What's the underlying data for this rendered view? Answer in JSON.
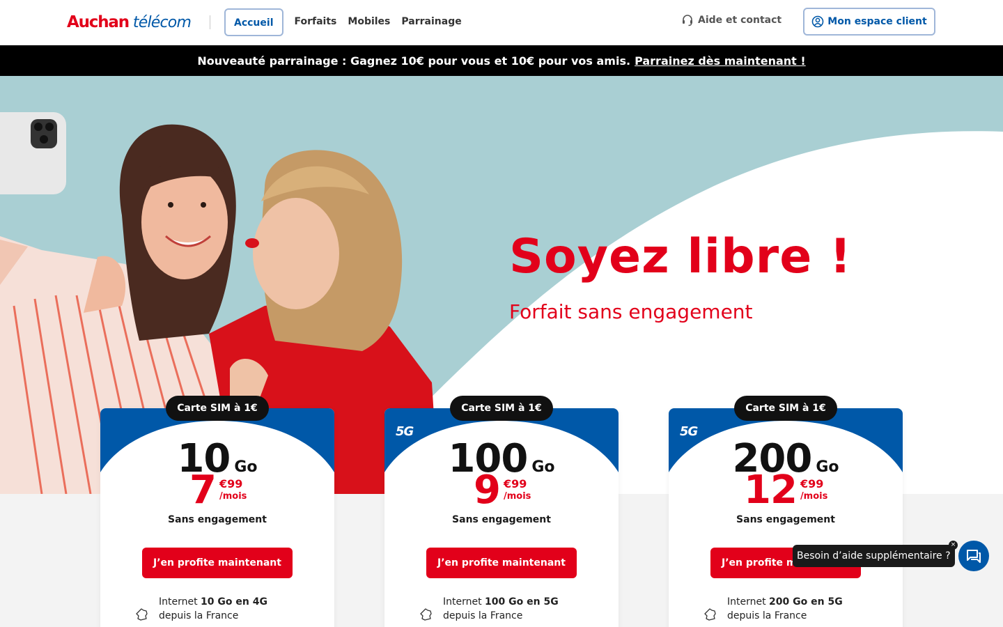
{
  "header": {
    "logo_primary": "Auchan",
    "logo_secondary": "télécom",
    "nav": [
      {
        "label": "Accueil",
        "active": true
      },
      {
        "label": "Forfaits",
        "active": false
      },
      {
        "label": "Mobiles",
        "active": false
      },
      {
        "label": "Parrainage",
        "active": false
      }
    ],
    "help_label": "Aide et contact",
    "help_icon": "headset-icon",
    "account_label": "Mon espace client",
    "account_icon": "user-circle-icon"
  },
  "promo": {
    "text": "Nouveauté parrainage : Gagnez 10€ pour vous et 10€ pour vos amis.",
    "link": "Parrainez dès maintenant !"
  },
  "hero": {
    "title": "Soyez libre !",
    "subtitle": "Forfait sans engagement"
  },
  "offers": [
    {
      "tag": "Carte SIM à 1€",
      "badge": "",
      "data_amount": "10",
      "data_unit": "Go",
      "price_int": "7",
      "price_cents": "€99",
      "price_period": "/mois",
      "commitment": "Sans engagement",
      "cta": "J’en profite maintenant",
      "feature_prefix": "Internet ",
      "feature_bold": "10 Go en 4G",
      "feature_suffix": "depuis la France"
    },
    {
      "tag": "Carte SIM à 1€",
      "badge": "5G",
      "data_amount": "100",
      "data_unit": "Go",
      "price_int": "9",
      "price_cents": "€99",
      "price_period": "/mois",
      "commitment": "Sans engagement",
      "cta": "J’en profite maintenant",
      "feature_prefix": "Internet ",
      "feature_bold": "100 Go en 5G",
      "feature_suffix": "depuis la France"
    },
    {
      "tag": "Carte SIM à 1€",
      "badge": "5G",
      "data_amount": "200",
      "data_unit": "Go",
      "price_int": "12",
      "price_cents": "€99",
      "price_period": "/mois",
      "commitment": "Sans engagement",
      "cta": "J’en profite maintenant",
      "feature_prefix": "Internet ",
      "feature_bold": "200 Go en 5G",
      "feature_suffix": "depuis la France"
    }
  ],
  "chat": {
    "bubble_text": "Besoin d’aide supplémentaire ?",
    "close_symbol": "×",
    "icon": "chat-icon"
  },
  "colors": {
    "brand_red": "#e2001a",
    "brand_blue": "#0058a8",
    "hero_bg": "#a9cfd3",
    "banner_bg": "#000000"
  }
}
